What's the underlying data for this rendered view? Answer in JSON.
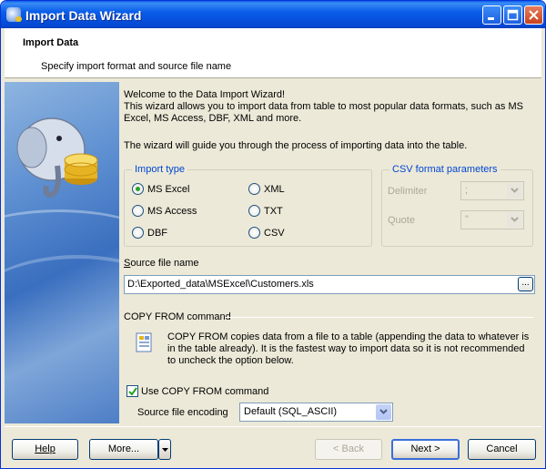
{
  "window": {
    "title": "Import Data Wizard"
  },
  "header": {
    "title": "Import Data",
    "subtitle": "Specify import format and source file name"
  },
  "intro": {
    "welcome": "Welcome to the Data Import Wizard!",
    "description": "This wizard allows you to import data from table to most popular data formats, such as MS Excel, MS Access, DBF, XML and more.",
    "guide": "The wizard will guide you through the process of importing data into the table."
  },
  "import_type": {
    "legend": "Import type",
    "options": [
      "MS Excel",
      "MS Access",
      "DBF",
      "XML",
      "TXT",
      "CSV"
    ],
    "selected": "MS Excel"
  },
  "csv": {
    "legend": "CSV format parameters",
    "delimiter_label": "Delimiter",
    "delimiter_value": ";",
    "quote_label": "Quote",
    "quote_value": "\""
  },
  "source": {
    "label_prefix": "S",
    "label_rest": "ource file name",
    "value": "D:\\Exported_data\\MSExcel\\Customers.xls",
    "browse": "..."
  },
  "copy_from": {
    "section": "COPY FROM command",
    "text": "COPY FROM copies data from a file to a table (appending the data to whatever is in the table already). It is the fastest way to import data so it is not recommended to uncheck the option below.",
    "checkbox_label": "Use COPY FROM command",
    "checked": true,
    "encoding_label": "Source file encoding",
    "encoding_value": "Default (SQL_ASCII)"
  },
  "buttons": {
    "help": "Help",
    "more": "More...",
    "back": "< Back",
    "next": "Next >",
    "cancel": "Cancel"
  }
}
